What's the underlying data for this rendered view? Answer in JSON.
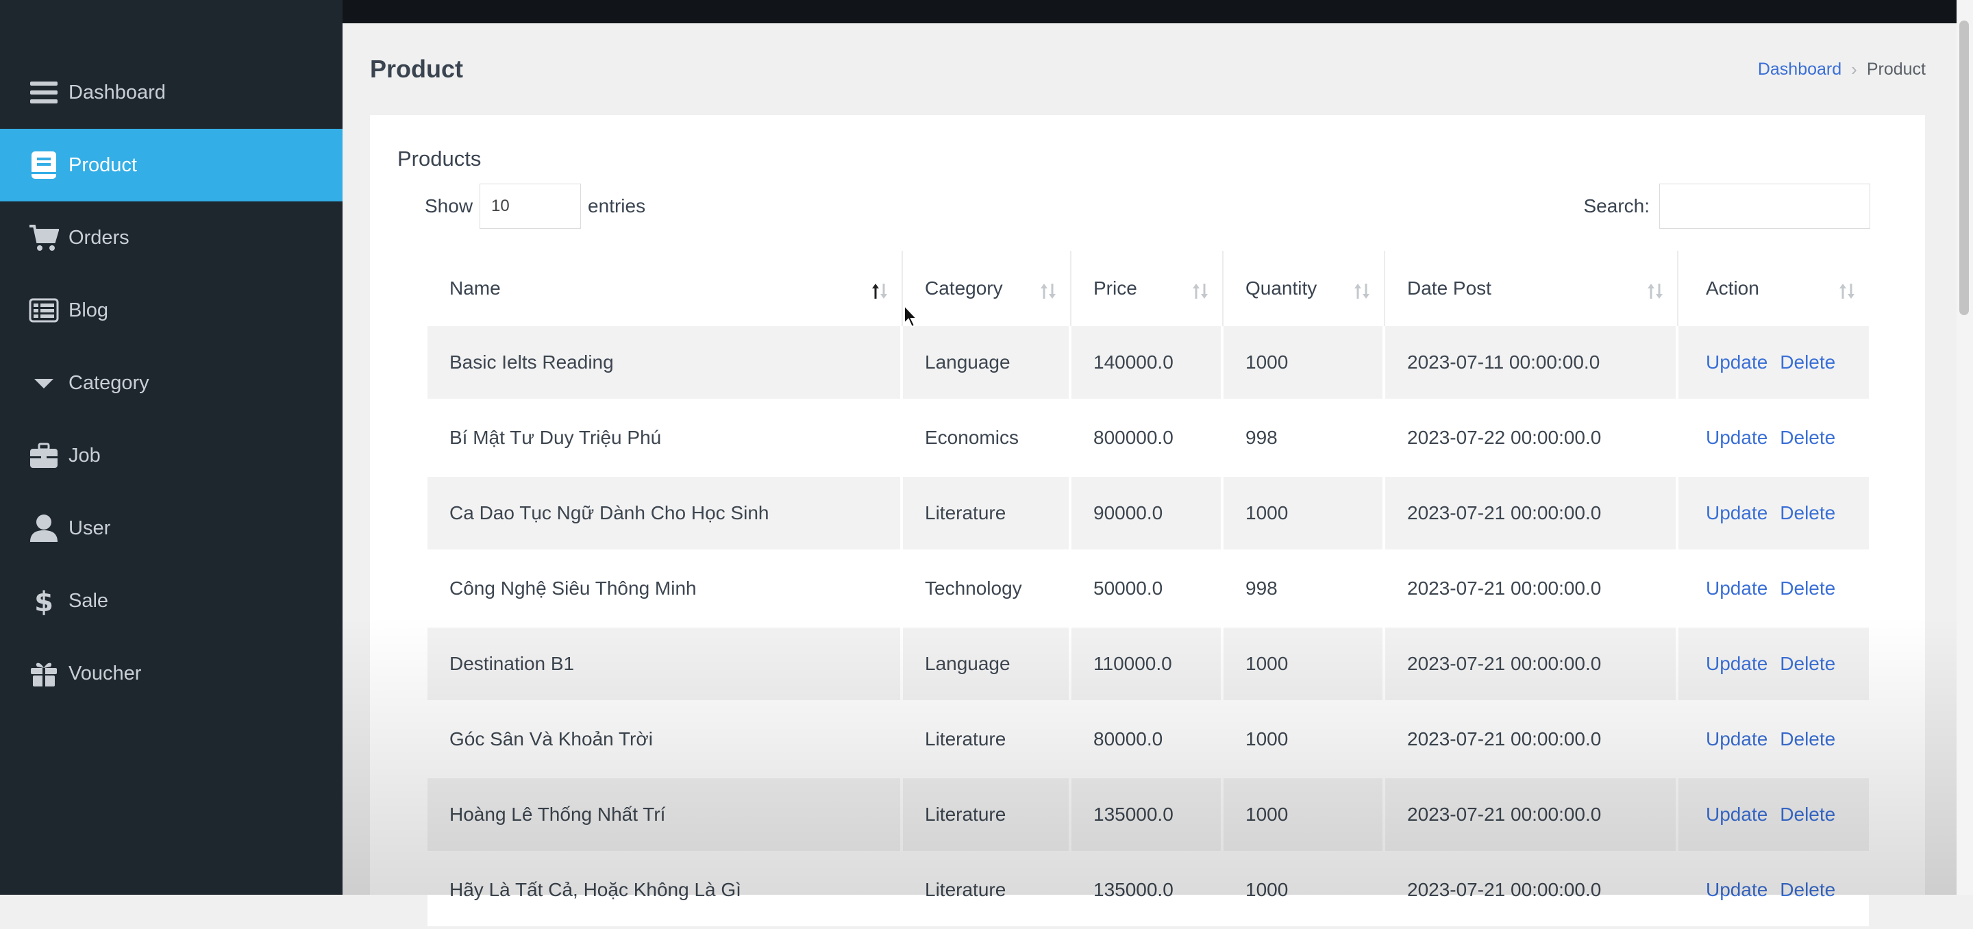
{
  "sidebar": {
    "items": [
      {
        "label": "Dashboard",
        "icon": "menu-icon"
      },
      {
        "label": "Product",
        "icon": "book-icon",
        "active": true
      },
      {
        "label": "Orders",
        "icon": "cart-icon"
      },
      {
        "label": "Blog",
        "icon": "list-icon"
      },
      {
        "label": "Category",
        "icon": "caret-down-icon"
      },
      {
        "label": "Job",
        "icon": "briefcase-icon"
      },
      {
        "label": "User",
        "icon": "user-icon"
      },
      {
        "label": "Sale",
        "icon": "dollar-icon"
      },
      {
        "label": "Voucher",
        "icon": "gift-icon"
      }
    ]
  },
  "page": {
    "title": "Product",
    "breadcrumb": {
      "link": "Dashboard",
      "current": "Product"
    }
  },
  "card": {
    "title": "Products",
    "length": {
      "show": "Show",
      "value": "10",
      "entries": "entries"
    },
    "search": {
      "label": "Search:",
      "value": ""
    }
  },
  "table": {
    "columns": [
      "Name",
      "Category",
      "Price",
      "Quantity",
      "Date Post",
      "Action"
    ],
    "sorted_column": "Name",
    "action_update": "Update",
    "action_delete": "Delete",
    "rows": [
      {
        "name": "Basic Ielts Reading",
        "category": "Language",
        "price": "140000.0",
        "quantity": "1000",
        "date": "2023-07-11 00:00:00.0"
      },
      {
        "name": "Bí Mật Tư Duy Triệu Phú",
        "category": "Economics",
        "price": "800000.0",
        "quantity": "998",
        "date": "2023-07-22 00:00:00.0"
      },
      {
        "name": "Ca Dao Tục Ngữ Dành Cho Học Sinh",
        "category": "Literature",
        "price": "90000.0",
        "quantity": "1000",
        "date": "2023-07-21 00:00:00.0"
      },
      {
        "name": "Công Nghệ Siêu Thông Minh",
        "category": "Technology",
        "price": "50000.0",
        "quantity": "998",
        "date": "2023-07-21 00:00:00.0"
      },
      {
        "name": "Destination B1",
        "category": "Language",
        "price": "110000.0",
        "quantity": "1000",
        "date": "2023-07-21 00:00:00.0"
      },
      {
        "name": "Góc Sân Và Khoản Trời",
        "category": "Literature",
        "price": "80000.0",
        "quantity": "1000",
        "date": "2023-07-21 00:00:00.0"
      },
      {
        "name": "Hoàng Lê Thống Nhất Trí",
        "category": "Literature",
        "price": "135000.0",
        "quantity": "1000",
        "date": "2023-07-21 00:00:00.0"
      },
      {
        "name": "Hãy Là Tất Cả, Hoặc Không Là Gì",
        "category": "Literature",
        "price": "135000.0",
        "quantity": "1000",
        "date": "2023-07-21 00:00:00.0"
      }
    ]
  },
  "colors": {
    "sidebar_bg": "#1e262e",
    "sidebar_active": "#33aee6",
    "link": "#3a6fd6"
  }
}
